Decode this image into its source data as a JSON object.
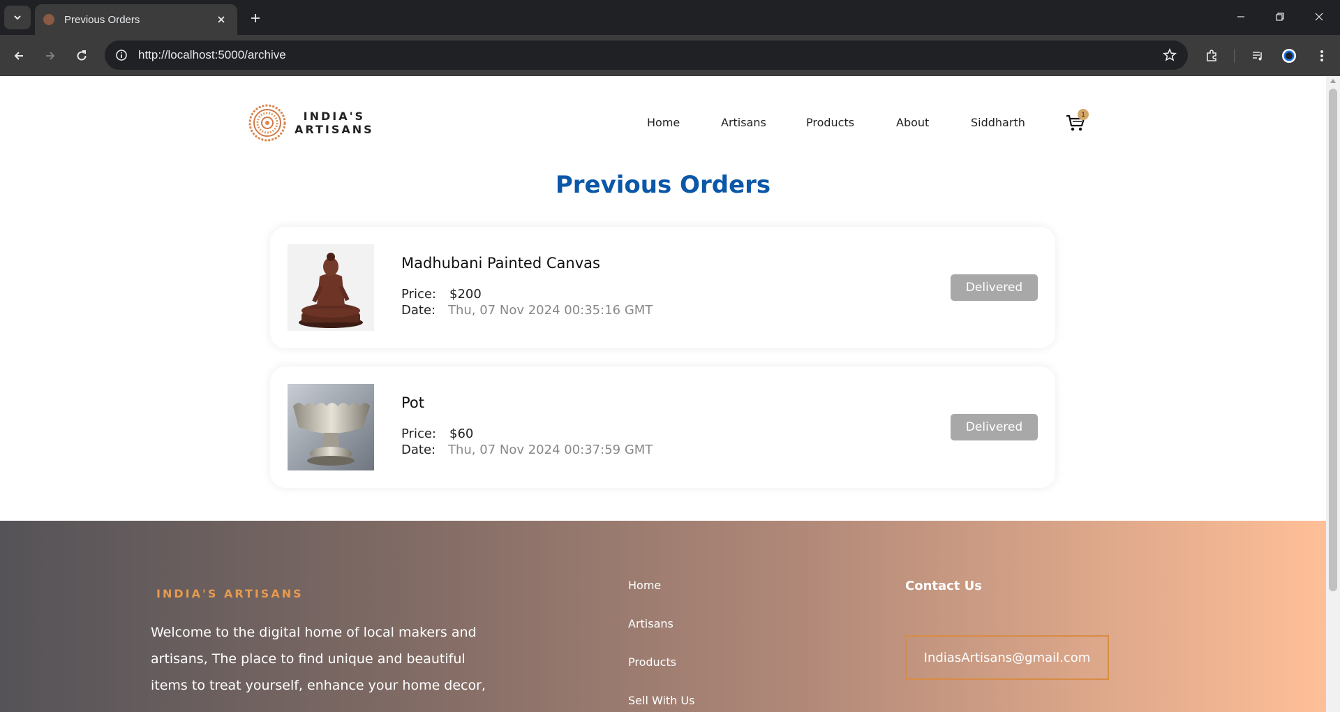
{
  "browser": {
    "tab_title": "Previous Orders",
    "url": "http://localhost:5000/archive"
  },
  "site": {
    "logo_line1": "INDIA'S",
    "logo_line2": "ARTISANS",
    "nav": [
      "Home",
      "Artisans",
      "Products",
      "About",
      "Siddharth"
    ],
    "cart_count": "1",
    "accent_color": "#0b57a8"
  },
  "page": {
    "title": "Previous Orders",
    "price_label": "Price:",
    "date_label": "Date:"
  },
  "orders": [
    {
      "name": "Madhubani Painted Canvas",
      "price": "$200",
      "date": "Thu, 07 Nov 2024 00:35:16 GMT",
      "status": "Delivered",
      "image_icon": "buddha-statue-image"
    },
    {
      "name": "Pot",
      "price": "$60",
      "date": "Thu, 07 Nov 2024 00:37:59 GMT",
      "status": "Delivered",
      "image_icon": "silver-bowl-image"
    }
  ],
  "footer": {
    "brand": "INDIA'S ARTISANS",
    "description": "Welcome to the digital home of local makers and artisans, The place to find unique and beautiful items to treat yourself, enhance your home decor,",
    "links": [
      "Home",
      "Artisans",
      "Products",
      "Sell With Us"
    ],
    "contact_title": "Contact Us",
    "email": "IndiasArtisans@gmail.com"
  }
}
